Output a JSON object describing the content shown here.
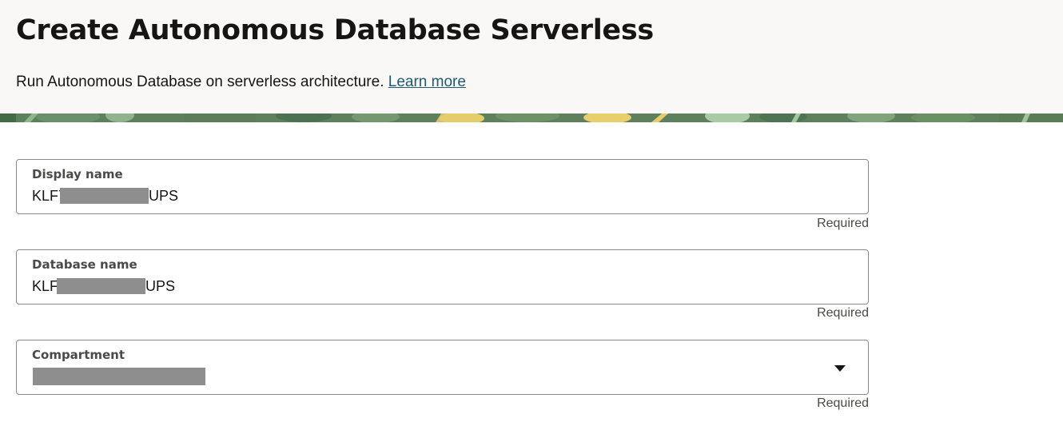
{
  "header": {
    "title": "Create Autonomous Database Serverless",
    "description": "Run Autonomous Database on serverless architecture.",
    "learn_more": "Learn more"
  },
  "form": {
    "display_name": {
      "label": "Display name",
      "value_prefix": "KLF7",
      "value_suffix": "UPS",
      "hint": "Required"
    },
    "database_name": {
      "label": "Database name",
      "value_prefix": "KLF",
      "value_suffix": "UPS",
      "hint": "Required"
    },
    "compartment": {
      "label": "Compartment",
      "hint": "Required"
    }
  },
  "colors": {
    "link": "#1e5a72",
    "header_bg": "#f9f8f6",
    "banner_green": "#5c7f5c"
  }
}
